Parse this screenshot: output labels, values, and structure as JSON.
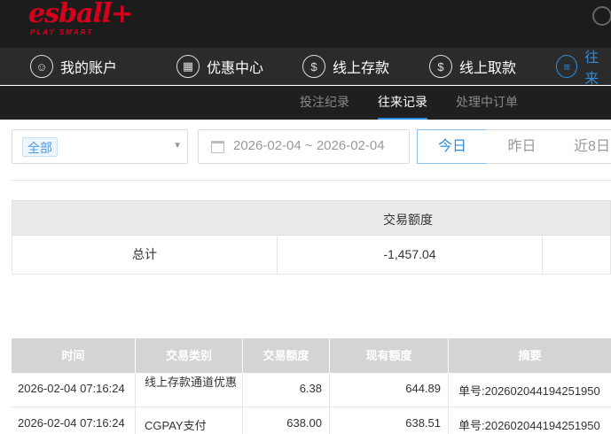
{
  "brand": {
    "name": "esball+",
    "tagline": "PLAY SMART"
  },
  "nav": {
    "items": [
      {
        "label": "我的账户",
        "icon": "user-icon"
      },
      {
        "label": "优惠中心",
        "icon": "gift-icon"
      },
      {
        "label": "线上存款",
        "icon": "deposit-icon"
      },
      {
        "label": "线上取款",
        "icon": "withdraw-icon"
      },
      {
        "label": "往来",
        "icon": "records-icon"
      }
    ]
  },
  "subnav": {
    "items": [
      {
        "label": "投注纪录"
      },
      {
        "label": "往来记录"
      },
      {
        "label": "处理中订单"
      }
    ]
  },
  "filter": {
    "category_selected": "全部",
    "date_range": "2026-02-04 ~ 2026-02-04",
    "quick_dates": [
      "今日",
      "昨日",
      "近8日"
    ]
  },
  "summary": {
    "header": "交易额度",
    "total_label": "总计",
    "total_value": "-1,457.04"
  },
  "table": {
    "columns": [
      "时间",
      "交易类别",
      "交易额度",
      "现有额度",
      "摘要"
    ],
    "rows": [
      {
        "time": "2026-02-04 07:16:24",
        "type": "线上存款通道优惠",
        "amount": "6.38",
        "balance": "644.89",
        "memo": "单号:202602044194251950"
      },
      {
        "time": "2026-02-04 07:16:24",
        "type": "CGPAY支付",
        "amount": "638.00",
        "balance": "638.51",
        "memo": "单号:202602044194251950"
      }
    ]
  },
  "colors": {
    "accent": "#2a8ce0",
    "brand": "#d6001c",
    "header_bg": "#1c1c1c"
  }
}
